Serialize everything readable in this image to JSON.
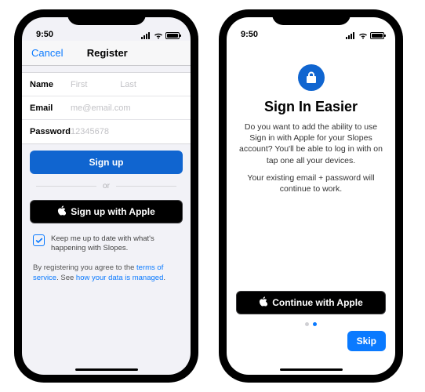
{
  "status": {
    "time": "9:50"
  },
  "left": {
    "nav": {
      "cancel": "Cancel",
      "title": "Register"
    },
    "fields": {
      "name_label": "Name",
      "first_placeholder": "First",
      "last_placeholder": "Last",
      "email_label": "Email",
      "email_placeholder": "me@email.com",
      "password_label": "Password",
      "password_placeholder": "12345678"
    },
    "signup_btn": "Sign up",
    "divider_or": "or",
    "apple_btn": "Sign up with Apple",
    "checkbox_text": "Keep me up to date with what's happening with Slopes.",
    "agree_pre": "By registering you agree to the ",
    "tos": "terms of service",
    "agree_mid": ". See ",
    "data_link": "how your data is managed",
    "agree_suf": "."
  },
  "right": {
    "title": "Sign In Easier",
    "para1": "Do you want to add the ability to use Sign in with Apple for your Slopes account? You'll be able to log in with on tap one all your devices.",
    "para2": "Your existing email + password will continue to work.",
    "continue_btn": "Continue with Apple",
    "skip_btn": "Skip"
  }
}
